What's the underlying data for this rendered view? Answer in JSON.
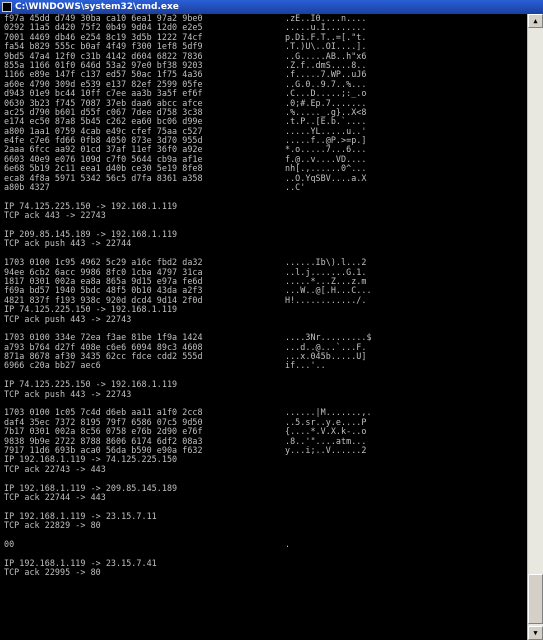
{
  "window": {
    "title": "C:\\WINDOWS\\system32\\cmd.exe",
    "icon": "cmd-icon",
    "scroll_up_glyph": "▲",
    "scroll_down_glyph": "▼"
  },
  "console": {
    "lines": [
      {
        "hex": "f97a 45dd d749 30ba ca10 6ea1 97a2 9be0",
        "ascii": ".zE..I0....n...."
      },
      {
        "hex": "0292 11a5 d420 75f2 0b49 9d04 12d0 e2e5",
        "ascii": ".....u.I........"
      },
      {
        "hex": "7001 4469 db46 e254 8c19 3d5b 1222 74cf",
        "ascii": "p.Di.F.T..=[.\"t."
      },
      {
        "hex": "fa54 b829 555c b0af 4f49 f300 1ef8 5df9",
        "ascii": ".T.)U\\..OI....]."
      },
      {
        "hex": "9bd5 47a4 12f0 c31b 4142 d604 6822 7836",
        "ascii": "..G.....AB..h\"x6"
      },
      {
        "hex": "855a 1166 01f0 646d 53a2 97e0 bf38 9203",
        "ascii": ".Z.f..dmS....8.."
      },
      {
        "hex": "1166 e89e 147f c137 ed57 50ac 1f75 4a36",
        "ascii": ".f.....7.WP..uJ6"
      },
      {
        "hex": "a60e 4790 309d e539 e137 82ef 2599 05fe",
        "ascii": "..G.0..9.7..%..."
      },
      {
        "hex": "d943 01e9 bc44 10ff c7ee aa3b 3a5f ef6f",
        "ascii": ".C...D.....;:_.o"
      },
      {
        "hex": "0630 3b23 f745 7087 37eb daa6 abcc afce",
        "ascii": ".0;#.Ep.7......."
      },
      {
        "hex": "ac25 d790 b601 d55f c067 7dee d758 3c38",
        "ascii": ".%....._.g}..X<8"
      },
      {
        "hex": "e174 ec50 87a8 5b45 c262 ea60 bc06 d99e",
        "ascii": ".t.P..[E.b.`...."
      },
      {
        "hex": "a800 1aa1 0759 4cab e49c cfef 75aa c527",
        "ascii": ".....YL.....u..'"
      },
      {
        "hex": "e4fe c7e6 fd66 0fb8 4050 873e 3d70 955d",
        "ascii": ".....f..@P.>=p.]"
      },
      {
        "hex": "2aaa 6fcc aa92 01cd 37af 11ef 36f0 a92e",
        "ascii": "*.o.....7...6..."
      },
      {
        "hex": "6603 40e9 e076 109d c7f0 5644 cb9a af1e",
        "ascii": "f.@..v....VD...."
      },
      {
        "hex": "6e68 5b19 2c11 eea1 d40b ce30 5e19 8fe8",
        "ascii": "nh[.,......0^..."
      },
      {
        "hex": "eca8 4f8a 5971 5342 56c5 d7fa 8361 a358",
        "ascii": "..O.YqSBV....a.X"
      },
      {
        "hex": "a80b 4327",
        "ascii": "..C'"
      },
      {
        "hex": "",
        "ascii": ""
      },
      {
        "hex": "IP 74.125.225.150 -> 192.168.1.119",
        "ascii": "",
        "full": true
      },
      {
        "hex": "TCP ack 443 -> 22743",
        "ascii": "",
        "full": true
      },
      {
        "hex": "",
        "ascii": ""
      },
      {
        "hex": "IP 209.85.145.189 -> 192.168.1.119",
        "ascii": "",
        "full": true
      },
      {
        "hex": "TCP ack push 443 -> 22744",
        "ascii": "",
        "full": true
      },
      {
        "hex": "",
        "ascii": ""
      },
      {
        "hex": "1703 0100 1c95 4962 5c29 a16c fbd2 da32",
        "ascii": "......Ib\\).l...2"
      },
      {
        "hex": "94ee 6cb2 6acc 9986 8fc0 1cba 4797 31ca",
        "ascii": "..l.j.......G.1."
      },
      {
        "hex": "1817 0301 002a ea8a 865a 9d15 e97a fe6d",
        "ascii": ".....*...Z...z.m"
      },
      {
        "hex": "f69a bd57 1940 5bdc 48f5 0b10 43da a2f3",
        "ascii": "...W..@[.H...C..."
      },
      {
        "hex": "4821 837f f193 938c 920d dcd4 9d14 2f0d",
        "ascii": "H!............/."
      },
      {
        "hex": "IP 74.125.225.150 -> 192.168.1.119",
        "ascii": "",
        "full": true
      },
      {
        "hex": "TCP ack push 443 -> 22743",
        "ascii": "",
        "full": true
      },
      {
        "hex": "",
        "ascii": ""
      },
      {
        "hex": "1703 0100 334e 72ea f3ae 81be 1f9a 1424",
        "ascii": "....3Nr.........$"
      },
      {
        "hex": "a793 b764 d27f 408e c6e6 6094 89c3 4608",
        "ascii": "...d..@...`...F."
      },
      {
        "hex": "871a 8678 af30 3435 62cc fdce cdd2 555d",
        "ascii": "...x.045b.....U]"
      },
      {
        "hex": "6966 c20a bb27 aec6",
        "ascii": "if...'.."
      },
      {
        "hex": "",
        "ascii": ""
      },
      {
        "hex": "IP 74.125.225.150 -> 192.168.1.119",
        "ascii": "",
        "full": true
      },
      {
        "hex": "TCP ack push 443 -> 22743",
        "ascii": "",
        "full": true
      },
      {
        "hex": "",
        "ascii": ""
      },
      {
        "hex": "1703 0100 1c05 7c4d d6eb aa11 a1f0 2cc8",
        "ascii": "......|M.......,."
      },
      {
        "hex": "daf4 35ec 7372 8195 79f7 6586 07c5 9d50",
        "ascii": "..5.sr..y.e....P"
      },
      {
        "hex": "7b17 0301 002a 8c56 0758 e76b 2d90 e76f",
        "ascii": "{....*.V.X.k-..o"
      },
      {
        "hex": "9838 9b9e 2722 8788 8606 6174 6df2 08a3",
        "ascii": ".8..'\"....atm..."
      },
      {
        "hex": "7917 11d6 693b aca0 56da b590 e90a f632",
        "ascii": "y...i;..V......2"
      },
      {
        "hex": "IP 192.168.1.119 -> 74.125.225.150",
        "ascii": "",
        "full": true
      },
      {
        "hex": "TCP ack 22743 -> 443",
        "ascii": "",
        "full": true
      },
      {
        "hex": "",
        "ascii": ""
      },
      {
        "hex": "IP 192.168.1.119 -> 209.85.145.189",
        "ascii": "",
        "full": true
      },
      {
        "hex": "TCP ack 22744 -> 443",
        "ascii": "",
        "full": true
      },
      {
        "hex": "",
        "ascii": ""
      },
      {
        "hex": "IP 192.168.1.119 -> 23.15.7.11",
        "ascii": "",
        "full": true
      },
      {
        "hex": "TCP ack 22829 -> 80",
        "ascii": "",
        "full": true
      },
      {
        "hex": "",
        "ascii": ""
      },
      {
        "hex": "00",
        "ascii": "."
      },
      {
        "hex": "",
        "ascii": ""
      },
      {
        "hex": "IP 192.168.1.119 -> 23.15.7.41",
        "ascii": "",
        "full": true
      },
      {
        "hex": "TCP ack 22995 -> 80",
        "ascii": "",
        "full": true
      }
    ]
  }
}
